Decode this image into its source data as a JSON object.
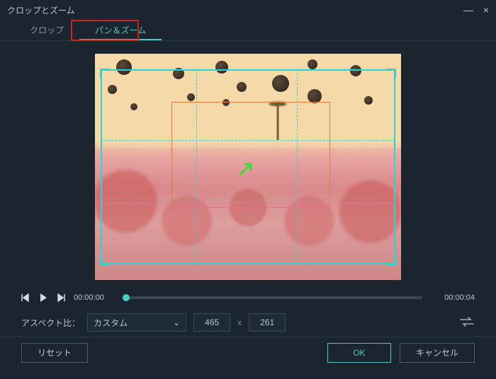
{
  "window": {
    "title": "クロップとズーム"
  },
  "tabs": {
    "crop": "クロップ",
    "panzoom": "パン＆ズーム",
    "active": "panzoom"
  },
  "transport": {
    "start": "00:00:00",
    "end": "00:00:04"
  },
  "aspect": {
    "label": "アスペクト比：",
    "selected": "カスタム",
    "width": "465",
    "height": "261",
    "separator": "x"
  },
  "buttons": {
    "reset": "リセット",
    "ok": "OK",
    "cancel": "キャンセル"
  },
  "icons": {
    "minimize": "—",
    "close": "×",
    "prev_frame": "◀|",
    "play": "▶",
    "next_frame": "|▶",
    "chevron_down": "⌄",
    "swap": "⇄"
  },
  "colors": {
    "accent": "#4ec9c9",
    "highlight": "#d81f1f",
    "inner_frame": "#e87a3a"
  }
}
